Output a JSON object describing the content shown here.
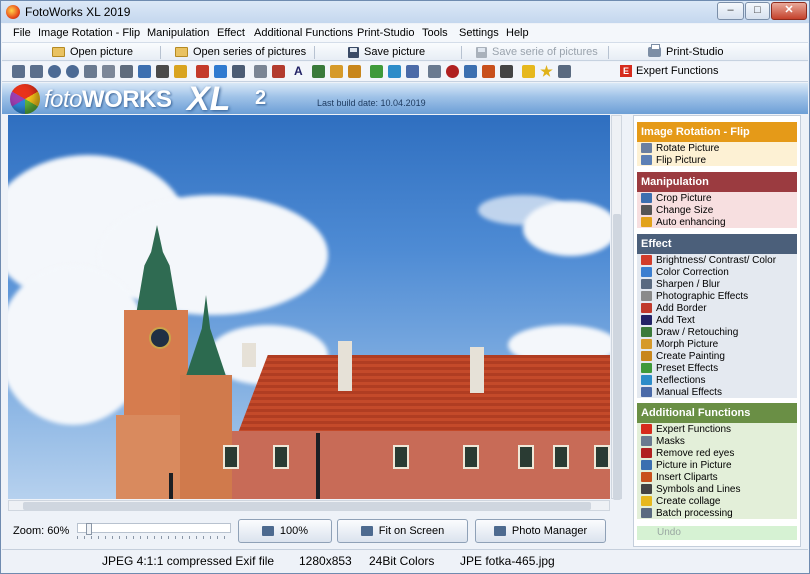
{
  "window": {
    "title": "FotoWorks XL 2019",
    "min_symbol": "–",
    "max_symbol": "□",
    "close_symbol": "✕"
  },
  "menu": [
    "File",
    "Image Rotation - Flip",
    "Manipulation",
    "Effect",
    "Additional Functions",
    "Print-Studio",
    "Tools",
    "Settings",
    "Help"
  ],
  "main_toolbar": {
    "open_picture": "Open picture",
    "open_series": "Open series of pictures",
    "save_picture": "Save picture",
    "save_serie": "Save serie of pictures",
    "print_studio": "Print-Studio"
  },
  "icon_toolbar": {
    "expert_functions": "Expert Functions",
    "expert_letter": "E"
  },
  "banner": {
    "logo_foto": "foto",
    "logo_works": "WORKS",
    "logo_xl": "XL",
    "logo_version": "2",
    "build_date": "Last build date:  10.04.2019"
  },
  "zoom": {
    "label": "Zoom: 60%",
    "btn_100": "100%",
    "btn_fit": "Fit on Screen",
    "btn_manager": "Photo Manager"
  },
  "status": {
    "format": "JPEG 4:1:1 compressed Exif file",
    "dimensions": "1280x853",
    "colors": "24Bit Colors",
    "file": "JPE fotka-465.jpg"
  },
  "panel": {
    "sections": [
      {
        "title": "Image Rotation - Flip",
        "head_color": "#e59a18",
        "item_bg": "#fdf1d4",
        "items": [
          {
            "label": "Rotate Picture",
            "icon_color": "#6a7fa0"
          },
          {
            "label": "Flip Picture",
            "icon_color": "#5c7fb5"
          }
        ]
      },
      {
        "title": "Manipulation",
        "head_color": "#9b3b40",
        "item_bg": "#f7dfe0",
        "items": [
          {
            "label": "Crop Picture",
            "icon_color": "#3c6fb0"
          },
          {
            "label": "Change Size",
            "icon_color": "#555555"
          },
          {
            "label": "Auto enhancing",
            "icon_color": "#e2a21b"
          }
        ]
      },
      {
        "title": "Effect",
        "head_color": "#4b5f7a",
        "item_bg": "#e4e9f0",
        "items": [
          {
            "label": "Brightness/ Contrast/ Color",
            "icon_color": "#d23c2b"
          },
          {
            "label": "Color Correction",
            "icon_color": "#3b7ed0"
          },
          {
            "label": "Sharpen / Blur",
            "icon_color": "#5a6a80"
          },
          {
            "label": "Photographic Effects",
            "icon_color": "#8a8a8a"
          },
          {
            "label": "Add Border",
            "icon_color": "#c0392b"
          },
          {
            "label": "Add Text",
            "icon_color": "#222266"
          },
          {
            "label": "Draw / Retouching",
            "icon_color": "#3a7a3a"
          },
          {
            "label": "Morph Picture",
            "icon_color": "#d69a2a"
          },
          {
            "label": "Create Painting",
            "icon_color": "#c8861c"
          },
          {
            "label": "Preset Effects",
            "icon_color": "#3f9a3a"
          },
          {
            "label": "Reflections",
            "icon_color": "#2c8cc9"
          },
          {
            "label": "Manual Effects",
            "icon_color": "#4a6aa8"
          }
        ]
      },
      {
        "title": "Additional Functions",
        "head_color": "#6a8f45",
        "item_bg": "#e3efd9",
        "items": [
          {
            "label": "Expert Functions",
            "icon_color": "#d62b1d"
          },
          {
            "label": "Masks",
            "icon_color": "#6a7a90"
          },
          {
            "label": "Remove red eyes",
            "icon_color": "#b02020"
          },
          {
            "label": "Picture in Picture",
            "icon_color": "#3b6fb0"
          },
          {
            "label": "Insert Cliparts",
            "icon_color": "#c8501c"
          },
          {
            "label": "Symbols and Lines",
            "icon_color": "#444444"
          },
          {
            "label": "Create collage",
            "icon_color": "#e6b81e"
          },
          {
            "label": "Batch processing",
            "icon_color": "#5a6a80"
          }
        ]
      }
    ],
    "undo": "Undo"
  }
}
